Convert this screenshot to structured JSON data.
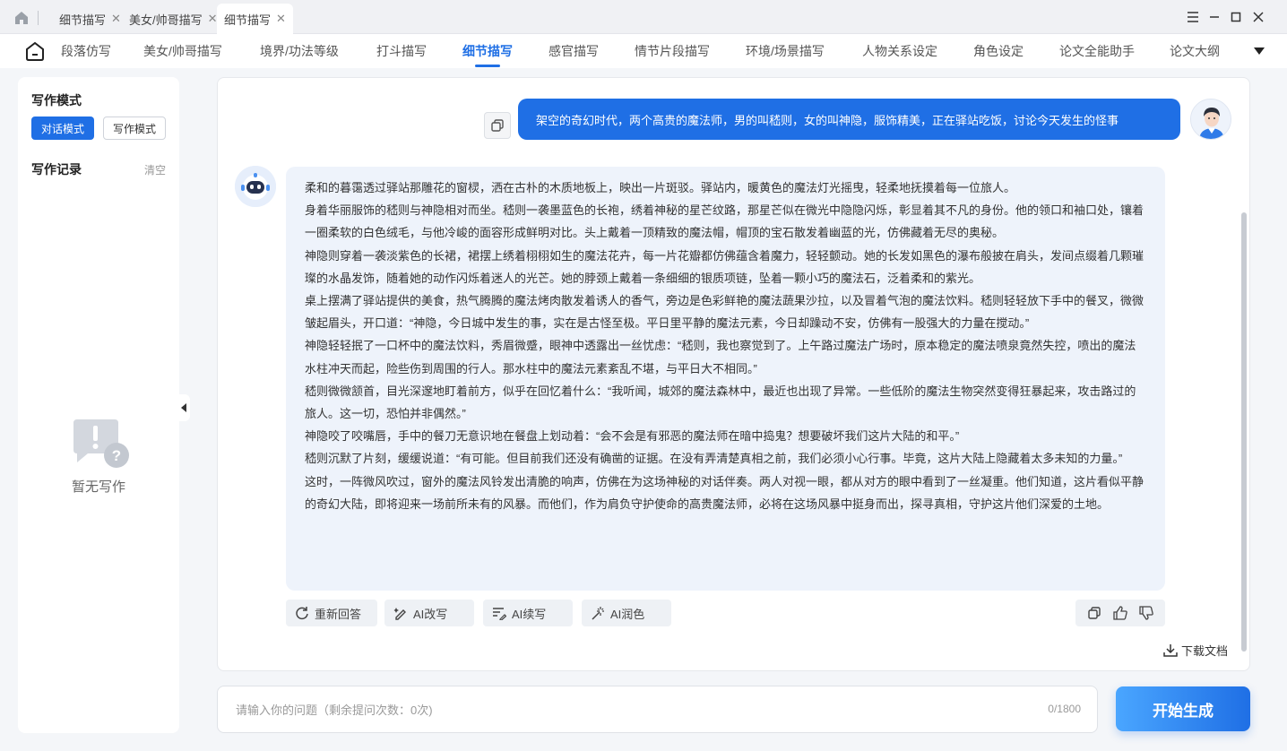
{
  "window_tabs": [
    {
      "label": "细节描写"
    },
    {
      "label": "美女/帅哥描写"
    },
    {
      "label": "细节描写"
    }
  ],
  "nav": {
    "items": [
      "段落仿写",
      "美女/帅哥描写",
      "境界/功法等级",
      "打斗描写",
      "细节描写",
      "感官描写",
      "情节片段描写",
      "环境/场景描写",
      "人物关系设定",
      "角色设定",
      "论文全能助手",
      "论文大纲"
    ],
    "active_index": 4
  },
  "sidebar": {
    "mode_title": "写作模式",
    "mode_dialog": "对话模式",
    "mode_writing": "写作模式",
    "record_title": "写作记录",
    "clear": "清空",
    "empty_text": "暂无写作"
  },
  "chat": {
    "user_message": "架空的奇幻时代，两个高贵的魔法师，男的叫嵇则，女的叫神隐，服饰精美，正在驿站吃饭，讨论今天发生的怪事",
    "bot_paragraphs": [
      "柔和的暮霭透过驿站那雕花的窗棂，洒在古朴的木质地板上，映出一片斑驳。驿站内，暖黄色的魔法灯光摇曳，轻柔地抚摸着每一位旅人。",
      "身着华丽服饰的嵇则与神隐相对而坐。嵇则一袭墨蓝色的长袍，绣着神秘的星芒纹路，那星芒似在微光中隐隐闪烁，彰显着其不凡的身份。他的领口和袖口处，镶着一圈柔软的白色绒毛，与他冷峻的面容形成鲜明对比。头上戴着一顶精致的魔法帽，帽顶的宝石散发着幽蓝的光，仿佛藏着无尽的奥秘。",
      "神隐则穿着一袭淡紫色的长裙，裙摆上绣着栩栩如生的魔法花卉，每一片花瓣都仿佛蕴含着魔力，轻轻颤动。她的长发如黑色的瀑布般披在肩头，发间点缀着几颗璀璨的水晶发饰，随着她的动作闪烁着迷人的光芒。她的脖颈上戴着一条细细的银质项链，坠着一颗小巧的魔法石，泛着柔和的紫光。",
      "桌上摆满了驿站提供的美食，热气腾腾的魔法烤肉散发着诱人的香气，旁边是色彩鲜艳的魔法蔬果沙拉，以及冒着气泡的魔法饮料。嵇则轻轻放下手中的餐叉，微微皱起眉头，开口道：“神隐，今日城中发生的事，实在是古怪至极。平日里平静的魔法元素，今日却躁动不安，仿佛有一股强大的力量在搅动。”",
      "神隐轻轻抿了一口杯中的魔法饮料，秀眉微蹙，眼神中透露出一丝忧虑：“嵇则，我也察觉到了。上午路过魔法广场时，原本稳定的魔法喷泉竟然失控，喷出的魔法水柱冲天而起，险些伤到周围的行人。那水柱中的魔法元素紊乱不堪，与平日大不相同。”",
      "嵇则微微颔首，目光深邃地盯着前方，似乎在回忆着什么：“我听闻，城郊的魔法森林中，最近也出现了异常。一些低阶的魔法生物突然变得狂暴起来，攻击路过的旅人。这一切，恐怕并非偶然。”",
      "神隐咬了咬嘴唇，手中的餐刀无意识地在餐盘上划动着：“会不会是有邪恶的魔法师在暗中捣鬼？想要破坏我们这片大陆的和平。”",
      "嵇则沉默了片刻，缓缓说道：“有可能。但目前我们还没有确凿的证据。在没有弄清楚真相之前，我们必须小心行事。毕竟，这片大陆上隐藏着太多未知的力量。”",
      "这时，一阵微风吹过，窗外的魔法风铃发出清脆的响声，仿佛在为这场神秘的对话伴奏。两人对视一眼，都从对方的眼中看到了一丝凝重。他们知道，这片看似平静的奇幻大陆，即将迎来一场前所未有的风暴。而他们，作为肩负守护使命的高贵魔法师，必将在这场风暴中挺身而出，探寻真相，守护这片他们深爱的土地。"
    ],
    "actions": {
      "regenerate": "重新回答",
      "ai_rewrite": "AI改写",
      "ai_continue": "AI续写",
      "ai_polish": "AI润色"
    },
    "download": "下载文档"
  },
  "input": {
    "placeholder": "请输入你的问题（剩余提问次数：0次)",
    "char_count": "0/1800",
    "submit": "开始生成"
  },
  "colors": {
    "accent": "#1f6fe5",
    "bot_bubble": "#eef3fb"
  }
}
